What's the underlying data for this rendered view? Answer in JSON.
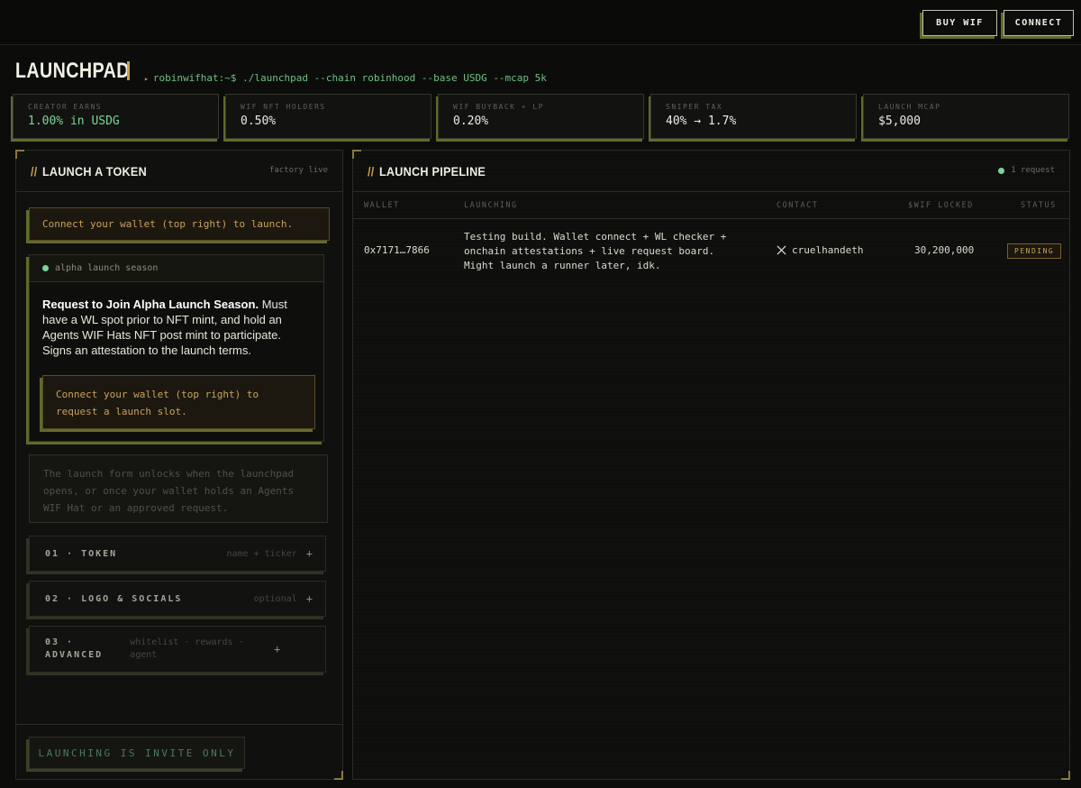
{
  "topbar": {
    "buy_label": "BUY WIF",
    "connect_label": "CONNECT"
  },
  "header": {
    "title": "LAUNCHPAD",
    "prompt_icon": "triangle-right",
    "command": "robinwifhat:~$ ./launchpad --chain robinhood --base USDG --mcap 5k"
  },
  "stats": [
    {
      "label": "CREATOR EARNS",
      "value": "1.00% in USDG"
    },
    {
      "label": "WIF NFT HOLDERS",
      "value": "0.50%"
    },
    {
      "label": "WIF BUYBACK + LP",
      "value": "0.20%"
    },
    {
      "label": "SNIPER TAX",
      "value": "40% → 1.7%"
    },
    {
      "label": "LAUNCH MCAP",
      "value": "$5,000"
    }
  ],
  "launch_panel": {
    "slash": "//",
    "title": "LAUNCH A TOKEN",
    "status": "factory live",
    "notice": "Connect your wallet (top right) to launch.",
    "alpha": {
      "tag": "alpha launch season",
      "heading": "Request to Join Alpha Launch Season.",
      "body": "Must have a WL spot prior to NFT mint, and hold an Agents WIF Hats NFT post mint to participate. Signs an attestation to the launch terms.",
      "notice_line1": "Connect your wallet (top right) to",
      "notice_line2": "request a launch slot."
    },
    "locked_line1": "The launch form unlocks when the launchpad",
    "locked_line2": "opens, or once your wallet holds an Agents",
    "locked_line3": "WIF Hat or an approved request.",
    "steps": [
      {
        "name": "01 · TOKEN",
        "hint": "name + ticker",
        "toggle": "+"
      },
      {
        "name": "02 · LOGO & SOCIALS",
        "hint": "optional",
        "toggle": "+"
      },
      {
        "name_line1": "03 ·",
        "name_line2": "ADVANCED",
        "hint_line1": "whitelist · rewards ·",
        "hint_line2": "agent",
        "toggle": "+"
      }
    ],
    "invite_label": "LAUNCHING IS INVITE ONLY"
  },
  "pipeline_panel": {
    "slash": "//",
    "title": "LAUNCH PIPELINE",
    "count": "1 request",
    "columns": [
      "WALLET",
      "LAUNCHING",
      "CONTACT",
      "$WIF LOCKED",
      "STATUS"
    ],
    "rows": [
      {
        "wallet": "0x7171…7866",
        "launching_line1": "Testing build. Wallet connect + WL checker +",
        "launching_line2": "onchain attestations + live request board.",
        "launching_line3": "Might launch a runner later, idk.",
        "contact": "cruelhandeth",
        "locked": "30,200,000",
        "status": "PENDING"
      }
    ]
  },
  "colors": {
    "accent_gold": "#c8a24a",
    "accent_green": "#7cd49a",
    "olive_shadow": "#5f6b2c",
    "background": "#0c0d0a"
  }
}
